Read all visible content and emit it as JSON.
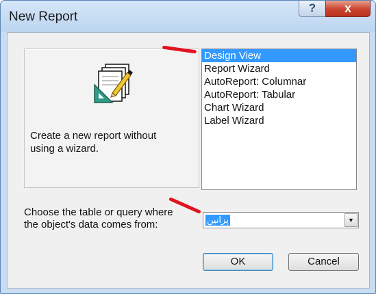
{
  "window": {
    "title": "New Report"
  },
  "titlebar_buttons": {
    "help": "?",
    "close": "x"
  },
  "preview": {
    "icon": "design-report-icon",
    "description": "Create a new report without\nusing a wizard."
  },
  "report_types": [
    {
      "label": "Design View",
      "selected": true
    },
    {
      "label": "Report Wizard",
      "selected": false
    },
    {
      "label": "AutoReport:  Columnar",
      "selected": false
    },
    {
      "label": "AutoReport:  Tabular",
      "selected": false
    },
    {
      "label": "Chart Wizard",
      "selected": false
    },
    {
      "label": "Label Wizard",
      "selected": false
    }
  ],
  "source": {
    "prompt": "Choose the table or query where\nthe object's data comes from:",
    "value": "پزانین"
  },
  "buttons": {
    "ok": "OK",
    "cancel": "Cancel"
  },
  "colors": {
    "selection": "#3399ff",
    "annotation": "#e0131e"
  }
}
